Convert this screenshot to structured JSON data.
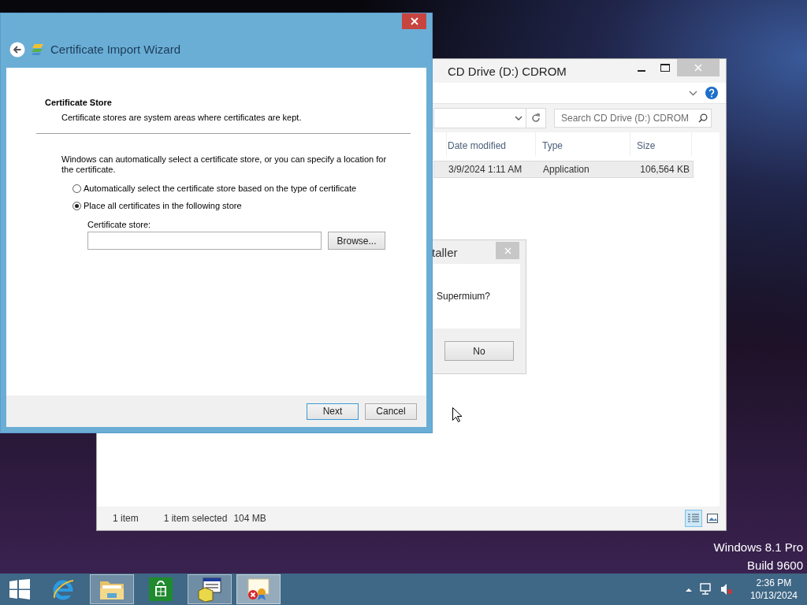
{
  "explorer": {
    "title": "CD Drive (D:) CDROM",
    "search": {
      "placeholder": "Search CD Drive (D:) CDROM"
    },
    "columns": [
      "Date modified",
      "Type",
      "Size"
    ],
    "rows": [
      {
        "cells": [
          "3/9/2024 1:11 AM",
          "Application",
          "106,564 KB"
        ],
        "selected": true
      }
    ],
    "status": [
      "1 item",
      "1 item selected",
      "104 MB"
    ],
    "views": [
      {
        "kind": "details",
        "selected": true
      },
      {
        "kind": "tiles",
        "selected": false
      }
    ]
  },
  "dialog": {
    "title": "taller",
    "message": "Supermium?",
    "buttons": [
      "No"
    ]
  },
  "wizard": {
    "title": "Certificate Import Wizard",
    "heading": "Certificate Store",
    "subheading": "Certificate stores are system areas where certificates are kept.",
    "description": "Windows can automatically select a certificate store, or you can specify a location for the certificate.",
    "options": [
      {
        "label": "Automatically select the certificate store based on the type of certificate",
        "selected": false
      },
      {
        "label": "Place all certificates in the following store",
        "selected": true
      }
    ],
    "store_label": "Certificate store:",
    "browse": "Browse...",
    "buttons": [
      "Next",
      "Cancel"
    ]
  },
  "edition": [
    "Windows 8.1 Pro",
    "Build 9600"
  ],
  "taskbar": {
    "apps": [
      {
        "kind": "start",
        "open": false,
        "selected": false
      },
      {
        "kind": "browser",
        "open": false,
        "selected": false
      },
      {
        "kind": "files",
        "open": true,
        "selected": false
      },
      {
        "kind": "store",
        "open": false,
        "selected": false
      },
      {
        "kind": "installer",
        "open": true,
        "selected": false
      },
      {
        "kind": "certificate",
        "open": true,
        "selected": true
      }
    ],
    "clock": {
      "time": "2:36 PM",
      "date": "10/13/2024"
    }
  }
}
